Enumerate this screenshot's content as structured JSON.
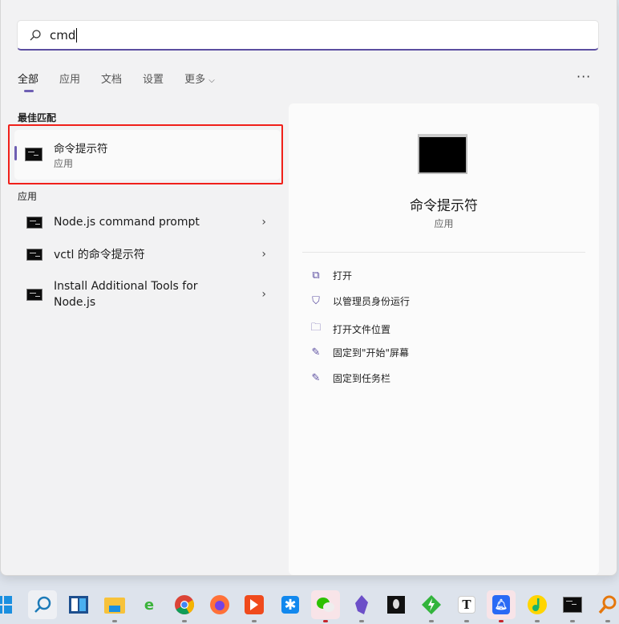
{
  "search": {
    "value": "cmd"
  },
  "tabs": [
    {
      "label": "全部"
    },
    {
      "label": "应用"
    },
    {
      "label": "文档"
    },
    {
      "label": "设置"
    },
    {
      "label": "更多"
    }
  ],
  "more_icon": "ellipsis-icon",
  "best_match": {
    "section": "最佳匹配",
    "title": "命令提示符",
    "subtitle": "应用"
  },
  "apps": {
    "section": "应用",
    "items": [
      {
        "label": "Node.js command prompt"
      },
      {
        "label": "vctl 的命令提示符"
      },
      {
        "label": "Install Additional Tools for Node.js"
      }
    ]
  },
  "preview": {
    "title": "命令提示符",
    "subtitle": "应用",
    "actions": [
      {
        "label": "打开",
        "icon": "open-external-icon"
      },
      {
        "label": "以管理员身份运行",
        "icon": "shield-admin-icon"
      },
      {
        "label": "打开文件位置",
        "icon": "folder-icon"
      },
      {
        "label": "固定到\"开始\"屏幕",
        "icon": "pin-icon"
      },
      {
        "label": "固定到任务栏",
        "icon": "pin-icon"
      }
    ]
  },
  "taskbar": [
    {
      "name": "start",
      "icon": "windows-icon"
    },
    {
      "name": "search",
      "icon": "search-icon"
    },
    {
      "name": "widgets",
      "icon": "widgets-icon"
    },
    {
      "name": "file-explorer",
      "icon": "folder-icon"
    },
    {
      "name": "ie-browser",
      "icon": "ie-icon"
    },
    {
      "name": "chrome",
      "icon": "chrome-icon"
    },
    {
      "name": "firefox",
      "icon": "firefox-icon"
    },
    {
      "name": "app-k",
      "icon": "k-icon"
    },
    {
      "name": "app-star",
      "icon": "star-icon"
    },
    {
      "name": "wechat",
      "icon": "wechat-icon"
    },
    {
      "name": "obsidian",
      "icon": "obsidian-icon"
    },
    {
      "name": "alienware",
      "icon": "alien-icon"
    },
    {
      "name": "xunlei",
      "icon": "bolt-icon"
    },
    {
      "name": "typora",
      "icon": "t-icon"
    },
    {
      "name": "notification-app",
      "icon": "bell-icon"
    },
    {
      "name": "qq-music",
      "icon": "music-icon"
    },
    {
      "name": "terminal",
      "icon": "cmd-icon"
    },
    {
      "name": "search-tool",
      "icon": "magnifier-icon"
    }
  ]
}
